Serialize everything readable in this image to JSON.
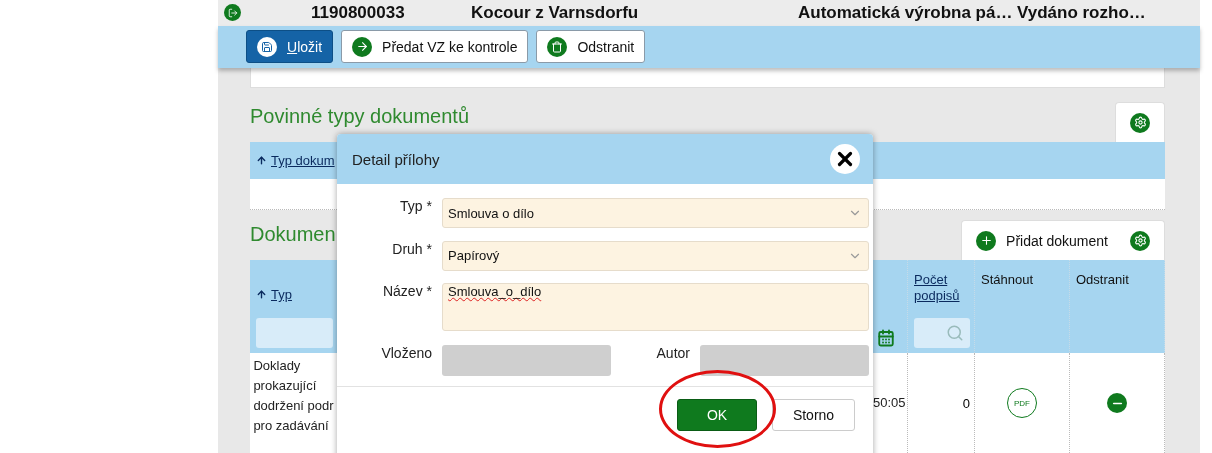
{
  "header": {
    "items": [
      "1190800033",
      "Kocour z Varnsdorfu",
      "Automatická výrobna pá…",
      "Vydáno rozho…"
    ]
  },
  "toolbar": {
    "buttons": [
      {
        "label": "Uložit",
        "kind": "save"
      },
      {
        "label": "Předat VZ ke kontrole",
        "kind": "forward"
      },
      {
        "label": "Odstranit",
        "kind": "delete"
      }
    ]
  },
  "required_types": {
    "title": "Povinné typy dokumentů",
    "column": "Typ dokum"
  },
  "documents": {
    "title": "Dokumen",
    "add_button": "Přidat dokument",
    "columns": {
      "type": "Typ",
      "signatures": "Počet podpisů",
      "download": "Stáhnout",
      "remove": "Odstranit"
    },
    "rows": [
      {
        "type_lines": [
          "Doklady",
          "prokazující",
          "dodržení podr",
          "pro zadávání"
        ],
        "time": "50:05",
        "signatures": "0",
        "download": "PDF"
      }
    ]
  },
  "dialog": {
    "title": "Detail přílohy",
    "fields": [
      {
        "label": "Typ *",
        "value": "Smlouva o dílo",
        "kind": "select"
      },
      {
        "label": "Druh *",
        "value": "Papírový",
        "kind": "select"
      },
      {
        "label": "Název *",
        "value": "Smlouva_o_dílo",
        "kind": "textarea"
      }
    ],
    "meta_labels": [
      "Vloženo",
      "Autor"
    ],
    "ok": "OK",
    "cancel": "Storno"
  }
}
